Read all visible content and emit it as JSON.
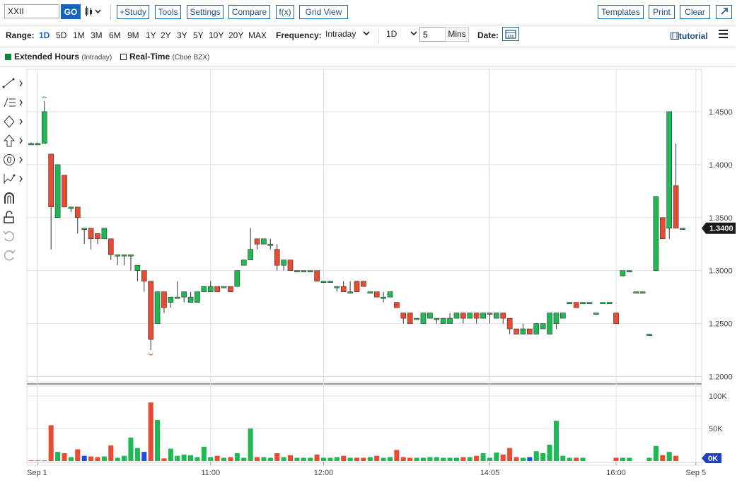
{
  "toolbar": {
    "symbol": "XXII",
    "go_label": "GO",
    "study_label": "+Study",
    "tools_label": "Tools",
    "settings_label": "Settings",
    "compare_label": "Compare",
    "fx_label": "f(x)",
    "gridview_label": "Grid View",
    "templates_label": "Templates",
    "print_label": "Print",
    "clear_label": "Clear"
  },
  "range": {
    "label": "Range:",
    "options": [
      "1D",
      "5D",
      "1M",
      "3M",
      "6M",
      "9M",
      "1Y",
      "2Y",
      "3Y",
      "5Y",
      "10Y",
      "20Y",
      "MAX"
    ],
    "active": "1D"
  },
  "frequency": {
    "label": "Frequency:",
    "value": "Intraday",
    "period": "1D",
    "mins_value": "5",
    "mins_label": "Mins"
  },
  "date_label": "Date:",
  "tutorial_label": "tutorial",
  "legend": [
    {
      "name": "Extended Hours",
      "source": "(Intraday)",
      "color": "#0a8a3a",
      "checked": true
    },
    {
      "name": "Real-Time",
      "source": "(Cboe BZX)",
      "color": "#ffffff",
      "checked": false
    }
  ],
  "colors": {
    "up": "#1db954",
    "down": "#e84a32",
    "grid": "#e2e2e2",
    "label_bg": "#1a1a1a",
    "vol_blue": "#1f4fd6",
    "accent": "#1565c0"
  },
  "chart_data": {
    "type": "candlestick",
    "price_axis": {
      "ticks": [
        1.45,
        1.4,
        1.35,
        1.3,
        1.25,
        1.2
      ],
      "tick_labels": [
        "1.4500",
        "1.4000",
        "1.3500",
        "1.3000",
        "1.2500",
        "1.2000"
      ],
      "ylim": [
        1.195,
        1.49
      ]
    },
    "current_price": "1.3400",
    "volume_axis": {
      "tick_labels": [
        "100K",
        "50K",
        "0K"
      ],
      "ylim": [
        0,
        100000
      ]
    },
    "x_labels": [
      "Sep 1",
      "11:00",
      "12:00",
      "14:05",
      "16:00",
      "Sep 5"
    ],
    "candles": [
      {
        "o": 1.42,
        "h": 1.421,
        "l": 1.419,
        "c": 1.42,
        "v": 1000
      },
      {
        "o": 1.42,
        "h": 1.421,
        "l": 1.419,
        "c": 1.42,
        "v": 1000
      },
      {
        "o": 1.42,
        "h": 1.46,
        "l": 1.42,
        "c": 1.45,
        "v": 1000
      },
      {
        "o": 1.41,
        "h": 1.41,
        "l": 1.32,
        "c": 1.36,
        "v": 55000
      },
      {
        "o": 1.35,
        "h": 1.4,
        "l": 1.35,
        "c": 1.4,
        "v": 14000
      },
      {
        "o": 1.39,
        "h": 1.39,
        "l": 1.36,
        "c": 1.36,
        "v": 12000
      },
      {
        "o": 1.36,
        "h": 1.36,
        "l": 1.355,
        "c": 1.36,
        "v": 6000
      },
      {
        "o": 1.36,
        "h": 1.36,
        "l": 1.335,
        "c": 1.35,
        "v": 18000
      },
      {
        "o": 1.34,
        "h": 1.34,
        "l": 1.325,
        "c": 1.34,
        "v": 8000
      },
      {
        "o": 1.34,
        "h": 1.34,
        "l": 1.32,
        "c": 1.33,
        "v": 7000
      },
      {
        "o": 1.335,
        "h": 1.335,
        "l": 1.325,
        "c": 1.33,
        "v": 6000
      },
      {
        "o": 1.33,
        "h": 1.34,
        "l": 1.33,
        "c": 1.34,
        "v": 7000
      },
      {
        "o": 1.33,
        "h": 1.33,
        "l": 1.31,
        "c": 1.315,
        "v": 24000
      },
      {
        "o": 1.315,
        "h": 1.315,
        "l": 1.305,
        "c": 1.315,
        "v": 5000
      },
      {
        "o": 1.315,
        "h": 1.315,
        "l": 1.305,
        "c": 1.315,
        "v": 8000
      },
      {
        "o": 1.315,
        "h": 1.315,
        "l": 1.3,
        "c": 1.315,
        "v": 36000
      },
      {
        "o": 1.3,
        "h": 1.3,
        "l": 1.29,
        "c": 1.305,
        "v": 20000
      },
      {
        "o": 1.3,
        "h": 1.3,
        "l": 1.28,
        "c": 1.29,
        "v": 14000
      },
      {
        "o": 1.29,
        "h": 1.29,
        "l": 1.225,
        "c": 1.235,
        "v": 90000
      },
      {
        "o": 1.25,
        "h": 1.28,
        "l": 1.25,
        "c": 1.28,
        "v": 63000
      },
      {
        "o": 1.28,
        "h": 1.28,
        "l": 1.26,
        "c": 1.265,
        "v": 4000
      },
      {
        "o": 1.27,
        "h": 1.27,
        "l": 1.265,
        "c": 1.275,
        "v": 19000
      },
      {
        "o": 1.275,
        "h": 1.29,
        "l": 1.275,
        "c": 1.275,
        "v": 8000
      },
      {
        "o": 1.275,
        "h": 1.28,
        "l": 1.27,
        "c": 1.28,
        "v": 10000
      },
      {
        "o": 1.27,
        "h": 1.28,
        "l": 1.27,
        "c": 1.275,
        "v": 9000
      },
      {
        "o": 1.27,
        "h": 1.27,
        "l": 1.27,
        "c": 1.28,
        "v": 6000
      },
      {
        "o": 1.28,
        "h": 1.285,
        "l": 1.28,
        "c": 1.285,
        "v": 22000
      },
      {
        "o": 1.28,
        "h": 1.29,
        "l": 1.28,
        "c": 1.285,
        "v": 6000
      },
      {
        "o": 1.285,
        "h": 1.285,
        "l": 1.28,
        "c": 1.28,
        "v": 8000
      },
      {
        "o": 1.285,
        "h": 1.285,
        "l": 1.285,
        "c": 1.285,
        "v": 5000
      },
      {
        "o": 1.285,
        "h": 1.285,
        "l": 1.28,
        "c": 1.28,
        "v": 6000
      },
      {
        "o": 1.285,
        "h": 1.3,
        "l": 1.285,
        "c": 1.3,
        "v": 12000
      },
      {
        "o": 1.305,
        "h": 1.305,
        "l": 1.305,
        "c": 1.31,
        "v": 5000
      },
      {
        "o": 1.31,
        "h": 1.34,
        "l": 1.31,
        "c": 1.32,
        "v": 50000
      },
      {
        "o": 1.33,
        "h": 1.33,
        "l": 1.32,
        "c": 1.325,
        "v": 6000
      },
      {
        "o": 1.325,
        "h": 1.33,
        "l": 1.325,
        "c": 1.33,
        "v": 6000
      },
      {
        "o": 1.325,
        "h": 1.33,
        "l": 1.32,
        "c": 1.325,
        "v": 5000
      },
      {
        "o": 1.32,
        "h": 1.325,
        "l": 1.3,
        "c": 1.305,
        "v": 12000
      },
      {
        "o": 1.305,
        "h": 1.305,
        "l": 1.3,
        "c": 1.31,
        "v": 6000
      },
      {
        "o": 1.31,
        "h": 1.31,
        "l": 1.305,
        "c": 1.3,
        "v": 9000
      },
      {
        "o": 1.3,
        "h": 1.3,
        "l": 1.3,
        "c": 1.3,
        "v": 5000
      },
      {
        "o": 1.3,
        "h": 1.3,
        "l": 1.3,
        "c": 1.3,
        "v": 5000
      },
      {
        "o": 1.3,
        "h": 1.3,
        "l": 1.3,
        "c": 1.3,
        "v": 5000
      },
      {
        "o": 1.3,
        "h": 1.3,
        "l": 1.29,
        "c": 1.29,
        "v": 10000
      },
      {
        "o": 1.29,
        "h": 1.29,
        "l": 1.29,
        "c": 1.29,
        "v": 5000
      },
      {
        "o": 1.29,
        "h": 1.29,
        "l": 1.29,
        "c": 1.29,
        "v": 5000
      },
      {
        "o": 1.285,
        "h": 1.285,
        "l": 1.28,
        "c": 1.285,
        "v": 6000
      },
      {
        "o": 1.285,
        "h": 1.29,
        "l": 1.285,
        "c": 1.28,
        "v": 8000
      },
      {
        "o": 1.28,
        "h": 1.29,
        "l": 1.28,
        "c": 1.28,
        "v": 5000
      },
      {
        "o": 1.29,
        "h": 1.29,
        "l": 1.28,
        "c": 1.28,
        "v": 5000
      },
      {
        "o": 1.29,
        "h": 1.29,
        "l": 1.285,
        "c": 1.285,
        "v": 5000
      },
      {
        "o": 1.28,
        "h": 1.28,
        "l": 1.28,
        "c": 1.28,
        "v": 6000
      },
      {
        "o": 1.28,
        "h": 1.28,
        "l": 1.275,
        "c": 1.275,
        "v": 8000
      },
      {
        "o": 1.275,
        "h": 1.28,
        "l": 1.27,
        "c": 1.275,
        "v": 5000
      },
      {
        "o": 1.275,
        "h": 1.28,
        "l": 1.275,
        "c": 1.28,
        "v": 6000
      },
      {
        "o": 1.27,
        "h": 1.27,
        "l": 1.265,
        "c": 1.265,
        "v": 17000
      },
      {
        "o": 1.26,
        "h": 1.26,
        "l": 1.25,
        "c": 1.255,
        "v": 6000
      },
      {
        "o": 1.26,
        "h": 1.26,
        "l": 1.25,
        "c": 1.25,
        "v": 5000
      },
      {
        "o": 1.255,
        "h": 1.255,
        "l": 1.255,
        "c": 1.255,
        "v": 5000
      },
      {
        "o": 1.25,
        "h": 1.26,
        "l": 1.25,
        "c": 1.26,
        "v": 5000
      },
      {
        "o": 1.255,
        "h": 1.26,
        "l": 1.255,
        "c": 1.26,
        "v": 6000
      },
      {
        "o": 1.255,
        "h": 1.255,
        "l": 1.25,
        "c": 1.255,
        "v": 6000
      },
      {
        "o": 1.25,
        "h": 1.255,
        "l": 1.25,
        "c": 1.255,
        "v": 5000
      },
      {
        "o": 1.25,
        "h": 1.26,
        "l": 1.25,
        "c": 1.255,
        "v": 5000
      },
      {
        "o": 1.255,
        "h": 1.26,
        "l": 1.255,
        "c": 1.26,
        "v": 5000
      },
      {
        "o": 1.26,
        "h": 1.26,
        "l": 1.25,
        "c": 1.255,
        "v": 6000
      },
      {
        "o": 1.255,
        "h": 1.26,
        "l": 1.255,
        "c": 1.26,
        "v": 6000
      },
      {
        "o": 1.26,
        "h": 1.26,
        "l": 1.25,
        "c": 1.255,
        "v": 8000
      },
      {
        "o": 1.255,
        "h": 1.26,
        "l": 1.255,
        "c": 1.26,
        "v": 12000
      },
      {
        "o": 1.26,
        "h": 1.26,
        "l": 1.25,
        "c": 1.26,
        "v": 5000
      },
      {
        "o": 1.255,
        "h": 1.26,
        "l": 1.255,
        "c": 1.26,
        "v": 13000
      },
      {
        "o": 1.26,
        "h": 1.26,
        "l": 1.25,
        "c": 1.255,
        "v": 10000
      },
      {
        "o": 1.255,
        "h": 1.255,
        "l": 1.24,
        "c": 1.245,
        "v": 20000
      },
      {
        "o": 1.245,
        "h": 1.245,
        "l": 1.24,
        "c": 1.24,
        "v": 6000
      },
      {
        "o": 1.24,
        "h": 1.25,
        "l": 1.24,
        "c": 1.245,
        "v": 5000
      },
      {
        "o": 1.245,
        "h": 1.245,
        "l": 1.24,
        "c": 1.24,
        "v": 6000
      },
      {
        "o": 1.24,
        "h": 1.25,
        "l": 1.24,
        "c": 1.25,
        "v": 15000
      },
      {
        "o": 1.245,
        "h": 1.245,
        "l": 1.245,
        "c": 1.25,
        "v": 12000
      },
      {
        "o": 1.24,
        "h": 1.26,
        "l": 1.24,
        "c": 1.26,
        "v": 25000
      },
      {
        "o": 1.25,
        "h": 1.26,
        "l": 1.245,
        "c": 1.26,
        "v": 62000
      },
      {
        "o": 1.255,
        "h": 1.26,
        "l": 1.255,
        "c": 1.26,
        "v": 8000
      },
      {
        "o": 1.27,
        "h": 1.27,
        "l": 1.27,
        "c": 1.27,
        "v": 5000
      },
      {
        "o": 1.27,
        "h": 1.27,
        "l": 1.265,
        "c": 1.265,
        "v": 5000
      },
      {
        "o": 1.27,
        "h": 1.27,
        "l": 1.27,
        "c": 1.27,
        "v": 5000
      },
      {
        "o": 1.27,
        "h": 1.27,
        "l": 1.27,
        "c": 1.27,
        "v": 0
      },
      {
        "o": 1.26,
        "h": 1.26,
        "l": 1.26,
        "c": 1.26,
        "v": 0
      },
      {
        "o": 1.27,
        "h": 1.27,
        "l": 1.27,
        "c": 1.27,
        "v": 0
      },
      {
        "o": 1.27,
        "h": 1.27,
        "l": 1.27,
        "c": 1.27,
        "v": 0
      },
      {
        "o": 1.26,
        "h": 1.26,
        "l": 1.25,
        "c": 1.25,
        "v": 5000
      },
      {
        "o": 1.295,
        "h": 1.3,
        "l": 1.295,
        "c": 1.3,
        "v": 5000
      },
      {
        "o": 1.3,
        "h": 1.3,
        "l": 1.3,
        "c": 1.3,
        "v": 5000
      },
      {
        "o": 1.28,
        "h": 1.28,
        "l": 1.28,
        "c": 1.28,
        "v": 0
      },
      {
        "o": 1.28,
        "h": 1.28,
        "l": 1.28,
        "c": 1.28,
        "v": 0
      },
      {
        "o": 1.24,
        "h": 1.24,
        "l": 1.24,
        "c": 1.24,
        "v": 5000
      },
      {
        "o": 1.3,
        "h": 1.37,
        "l": 1.3,
        "c": 1.37,
        "v": 23000
      },
      {
        "o": 1.35,
        "h": 1.35,
        "l": 1.33,
        "c": 1.33,
        "v": 9000
      },
      {
        "o": 1.34,
        "h": 1.45,
        "l": 1.33,
        "c": 1.45,
        "v": 14000
      },
      {
        "o": 1.38,
        "h": 1.42,
        "l": 1.34,
        "c": 1.34,
        "v": 8000
      },
      {
        "o": 1.34,
        "h": 1.34,
        "l": 1.34,
        "c": 1.34,
        "v": 0
      }
    ]
  }
}
